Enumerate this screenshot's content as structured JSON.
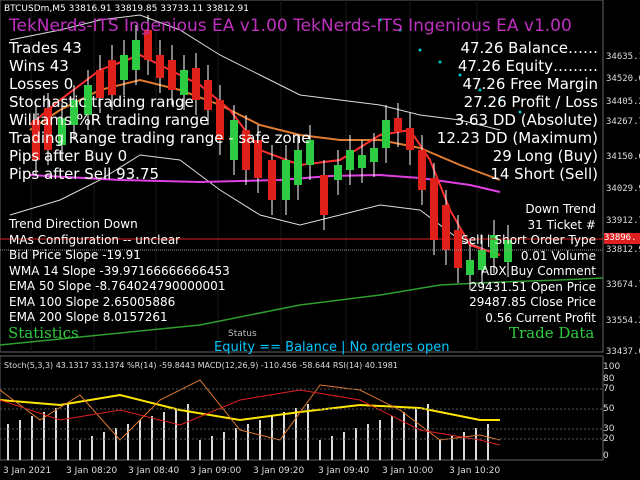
{
  "header": {
    "symbol_info": "BTCUSDm,M5  33816.91 33819.85 33733.11 33812.91",
    "ea_title": "TekNerds-ITS Ingenious EA v1.00 TekNerds-ITS Ingenious EA v1.00"
  },
  "left_stats": [
    "Trades 43",
    "Wins 43",
    "Losses 0",
    "Stochastic trading range",
    "Williams %R trading range",
    "Trading Range trading range - safe zone",
    "Pips after Buy 0",
    "Pips after Sell 93.75"
  ],
  "right_stats": [
    "47.26 Balance……",
    "47.26 Equity………",
    "47.26 Free Margin",
    "27.26 Profit / Loss",
    "3.63 DD (Absolute)",
    "12.23 DD (Maximum)",
    "29 Long (Buy)",
    "14 Short (Sell)"
  ],
  "lower_left": [
    "Trend Direction Down",
    "MAs Configuration -- unclear",
    "Bid Price Slope -19.91",
    "WMA 14 Slope -39.97166666666453",
    "EMA 50 Slope -8.764024790000001",
    "EMA 100 Slope 2.65005886",
    "EMA 200 Slope 8.0157261"
  ],
  "lower_right": [
    "Down Trend",
    "31 Ticket #",
    "Sell | Short Order Type",
    "0.01 Volume",
    "ADX Buy Comment",
    "29431.51 Open Price",
    "29487.85 Close Price",
    "0.56 Current Profit"
  ],
  "statistics_label": "Statistics",
  "trade_data_label": "Trade Data",
  "status_label": "Status",
  "status_text": "Equity == Balance | No orders open",
  "price_axis": [
    "34635.10",
    "34520.00",
    "34405.25",
    "34267.70",
    "34150.60",
    "34029.90",
    "33912.75",
    "33812.9",
    "33674.70",
    "33554.20",
    "33437.00"
  ],
  "current_price_box": "33896.",
  "time_axis": [
    "3 Jan 2021",
    "3 Jan 08:20",
    "3 Jan 08:40",
    "3 Jan 09:00",
    "3 Jan 09:20",
    "3 Jan 09:40",
    "3 Jan 10:00",
    "3 Jan 10:20"
  ],
  "subwindow": {
    "header": "Stoch(5,3,3) 43.1317 33.1374  %R(14) -59.8443  MACD(12,26,9) -110.456 -58.644  RSI(14) 40.1981",
    "scale": [
      "100",
      "80",
      "70",
      "50",
      "30",
      "20",
      "0"
    ]
  },
  "colors": {
    "background": "#000000",
    "bull_candle": "#2ecc40",
    "bear_candle": "#e0201a",
    "wma": "#ff3030",
    "ema50": "#e07a30",
    "ema100": "#e040e0",
    "ema200": "#2e9e2e",
    "title": "#c030c0",
    "status": "#00c8ff",
    "green_labels": "#2ecc40"
  }
}
